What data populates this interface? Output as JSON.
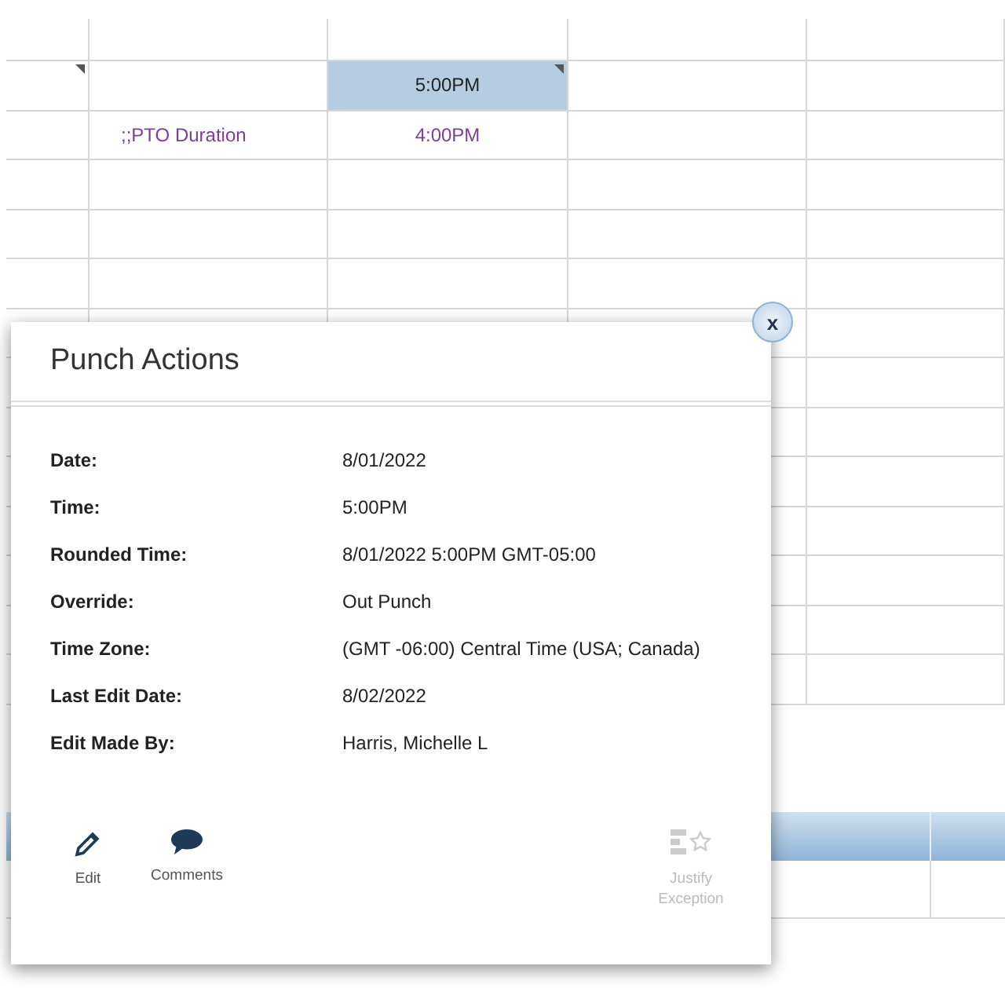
{
  "grid": {
    "rows": [
      {
        "kind": "punch",
        "cells": [
          {
            "text": "",
            "flagged": true,
            "selected": false
          },
          {
            "text": "",
            "flagged": false,
            "selected": false
          },
          {
            "text": "5:00PM",
            "flagged": true,
            "selected": true
          },
          {
            "text": "",
            "flagged": false,
            "selected": false
          },
          {
            "text": "",
            "flagged": false,
            "selected": false
          }
        ]
      },
      {
        "kind": "pto",
        "cells": [
          {
            "text": "",
            "flagged": false,
            "selected": false
          },
          {
            "text": ";;PTO Duration",
            "flagged": false,
            "selected": false
          },
          {
            "text": "4:00PM",
            "flagged": false,
            "selected": false
          },
          {
            "text": "",
            "flagged": false,
            "selected": false
          },
          {
            "text": "",
            "flagged": false,
            "selected": false
          }
        ]
      }
    ]
  },
  "dialog": {
    "title": "Punch Actions",
    "close": "x",
    "fields": [
      {
        "label": "Date:",
        "value": "8/01/2022"
      },
      {
        "label": "Time:",
        "value": "5:00PM"
      },
      {
        "label": "Rounded Time:",
        "value": "8/01/2022 5:00PM GMT-05:00"
      },
      {
        "label": "Override:",
        "value": "Out Punch"
      },
      {
        "label": "Time Zone:",
        "value": "(GMT -06:00) Central Time (USA; Canada)"
      },
      {
        "label": "Last Edit Date:",
        "value": "8/02/2022"
      },
      {
        "label": "Edit Made By:",
        "value": "Harris, Michelle L"
      }
    ],
    "actions": [
      {
        "kind": "edit",
        "label": "Edit",
        "disabled": false
      },
      {
        "kind": "comments",
        "label": "Comments",
        "disabled": false
      },
      {
        "kind": "justify",
        "label": "Justify Exception",
        "disabled": true
      }
    ]
  }
}
